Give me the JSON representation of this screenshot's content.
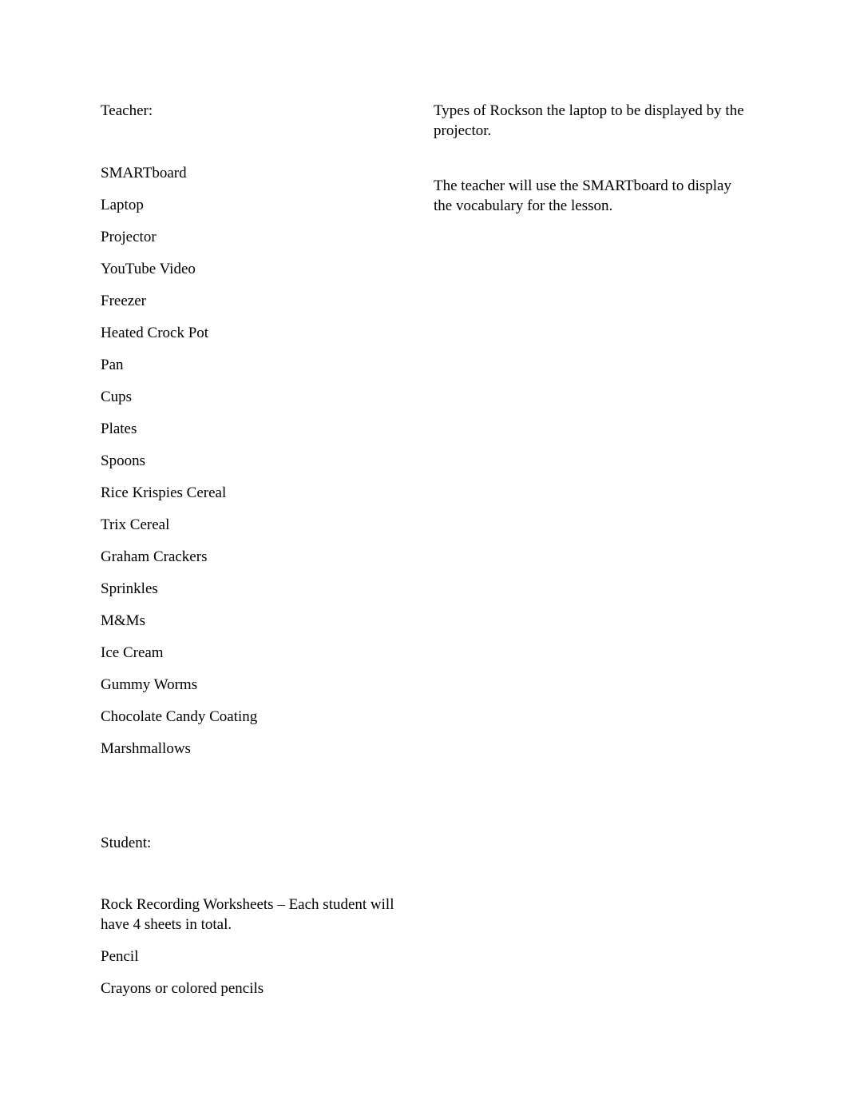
{
  "document": {
    "page_background": "#ffffff",
    "text_color": "#000000"
  },
  "left_column": {
    "teacher_heading": "Teacher:",
    "teacher_materials": [
      "SMARTboard",
      "Laptop",
      "Projector",
      "YouTube Video",
      "Freezer",
      "Heated Crock Pot",
      "Pan",
      "Cups",
      "Plates",
      "Spoons",
      "Rice Krispies Cereal",
      "Trix Cereal",
      "Graham Crackers",
      "Sprinkles",
      "M&Ms",
      "Ice Cream",
      "Gummy Worms",
      "Chocolate Candy Coating",
      "Marshmallows"
    ],
    "student_heading": "Student:",
    "student_materials": [
      "Rock Recording Worksheets – Each student will have 4 sheets in total.",
      "Pencil",
      "Crayons or colored pencils"
    ]
  },
  "right_column": {
    "notes": [
      "Types of Rockson the laptop to be displayed by the projector.",
      "The teacher will use the SMARTboard to display the vocabulary for the lesson."
    ]
  }
}
